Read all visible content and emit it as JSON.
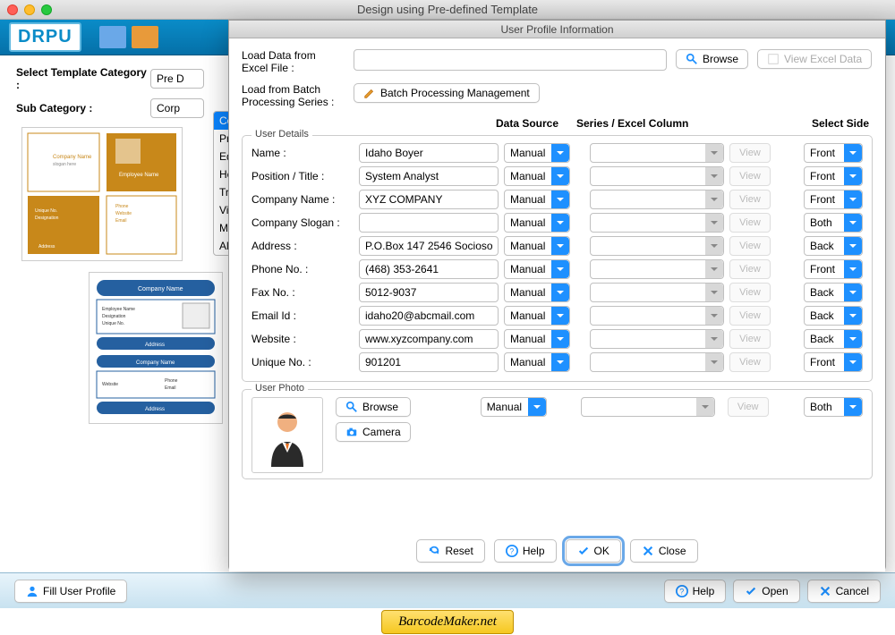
{
  "window": {
    "title": "Design using Pre-defined Template"
  },
  "logo": "DRPU",
  "category": {
    "template_label": "Select Template Category :",
    "template_value": "Pre D",
    "sub_label": "Sub Category :",
    "sub_value": "Corp",
    "items": [
      "Corp",
      "Pres",
      "Educ",
      "Heal",
      "Tran",
      "Visit",
      "Misc",
      "All ID"
    ]
  },
  "dialog": {
    "title": "User Profile Information",
    "load_excel_label": "Load Data from Excel File :",
    "browse": "Browse",
    "view_excel": "View Excel Data",
    "load_batch_label": "Load from Batch Processing Series :",
    "batch_btn": "Batch Processing Management",
    "user_details_label": "User Details",
    "headers": {
      "ds": "Data Source",
      "series": "Series / Excel Column",
      "side": "Select Side"
    },
    "fields": [
      {
        "label": "Name :",
        "value": "Idaho Boyer",
        "ds": "Manual",
        "side": "Front"
      },
      {
        "label": "Position / Title :",
        "value": "System Analyst",
        "ds": "Manual",
        "side": "Front"
      },
      {
        "label": "Company Name :",
        "value": "XYZ COMPANY",
        "ds": "Manual",
        "side": "Front"
      },
      {
        "label": "Company Slogan :",
        "value": "",
        "ds": "Manual",
        "side": "Both"
      },
      {
        "label": "Address :",
        "value": "P.O.Box 147 2546 Socioso",
        "ds": "Manual",
        "side": "Back"
      },
      {
        "label": "Phone No. :",
        "value": "(468) 353-2641",
        "ds": "Manual",
        "side": "Front"
      },
      {
        "label": "Fax No. :",
        "value": "5012-9037",
        "ds": "Manual",
        "side": "Back"
      },
      {
        "label": "Email Id :",
        "value": "idaho20@abcmail.com",
        "ds": "Manual",
        "side": "Back"
      },
      {
        "label": "Website :",
        "value": "www.xyzcompany.com",
        "ds": "Manual",
        "side": "Back"
      },
      {
        "label": "Unique No. :",
        "value": "901201",
        "ds": "Manual",
        "side": "Front"
      }
    ],
    "view": "View",
    "user_photo_label": "User Photo",
    "photo": {
      "browse": "Browse",
      "camera": "Camera",
      "ds": "Manual",
      "side": "Both"
    },
    "buttons": {
      "reset": "Reset",
      "help": "Help",
      "ok": "OK",
      "close": "Close"
    }
  },
  "bottom": {
    "fill_profile": "Fill User Profile",
    "help": "Help",
    "open": "Open",
    "cancel": "Cancel"
  },
  "brand": "BarcodeMaker.net"
}
